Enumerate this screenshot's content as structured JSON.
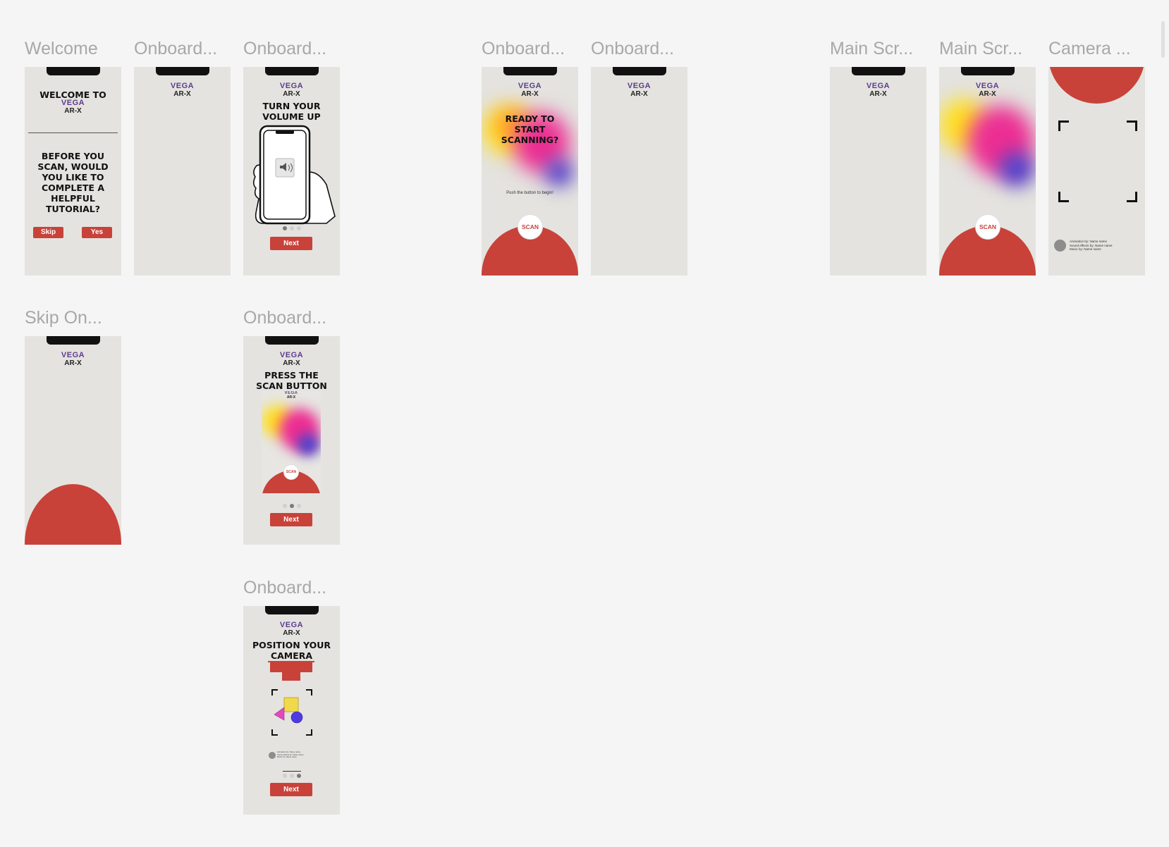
{
  "frames": [
    {
      "id": "welcome",
      "label": "Welcome"
    },
    {
      "id": "onboard-1",
      "label": "Onboard..."
    },
    {
      "id": "onboard-2",
      "label": "Onboard..."
    },
    {
      "id": "onboard-3",
      "label": "Onboard..."
    },
    {
      "id": "onboard-4",
      "label": "Onboard..."
    },
    {
      "id": "main-1",
      "label": "Main Scr..."
    },
    {
      "id": "main-2",
      "label": "Main Scr..."
    },
    {
      "id": "camera",
      "label": "Camera ..."
    },
    {
      "id": "skip",
      "label": "Skip On..."
    },
    {
      "id": "onboard-scan",
      "label": "Onboard..."
    },
    {
      "id": "onboard-camera",
      "label": "Onboard..."
    }
  ],
  "logo": {
    "line1": "VEGA",
    "line2": "AR-X"
  },
  "welcome": {
    "title": "WELCOME TO",
    "question": "BEFORE YOU SCAN, WOULD YOU LIKE TO COMPLETE A HELPFUL TUTORIAL?",
    "skip_label": "Skip",
    "yes_label": "Yes"
  },
  "volume": {
    "title": "TURN YOUR VOLUME UP",
    "next_label": "Next"
  },
  "ready": {
    "title": "READY TO START SCANNING?",
    "hint": "Push the button to begin!"
  },
  "scan_button_label": "SCAN",
  "press_scan": {
    "title": "PRESS THE SCAN BUTTON",
    "next_label": "Next"
  },
  "position_camera": {
    "title": "POSITION YOUR CAMERA",
    "next_label": "Next"
  },
  "camera_credits": [
    "Animation by: Name name",
    "Sound effects by: Name name",
    "Music by: Name name"
  ],
  "colors": {
    "accent": "#c8423a",
    "frame_bg": "#e4e3df",
    "canvas_bg": "#f5f5f5",
    "logo": "#5c3c8e"
  }
}
